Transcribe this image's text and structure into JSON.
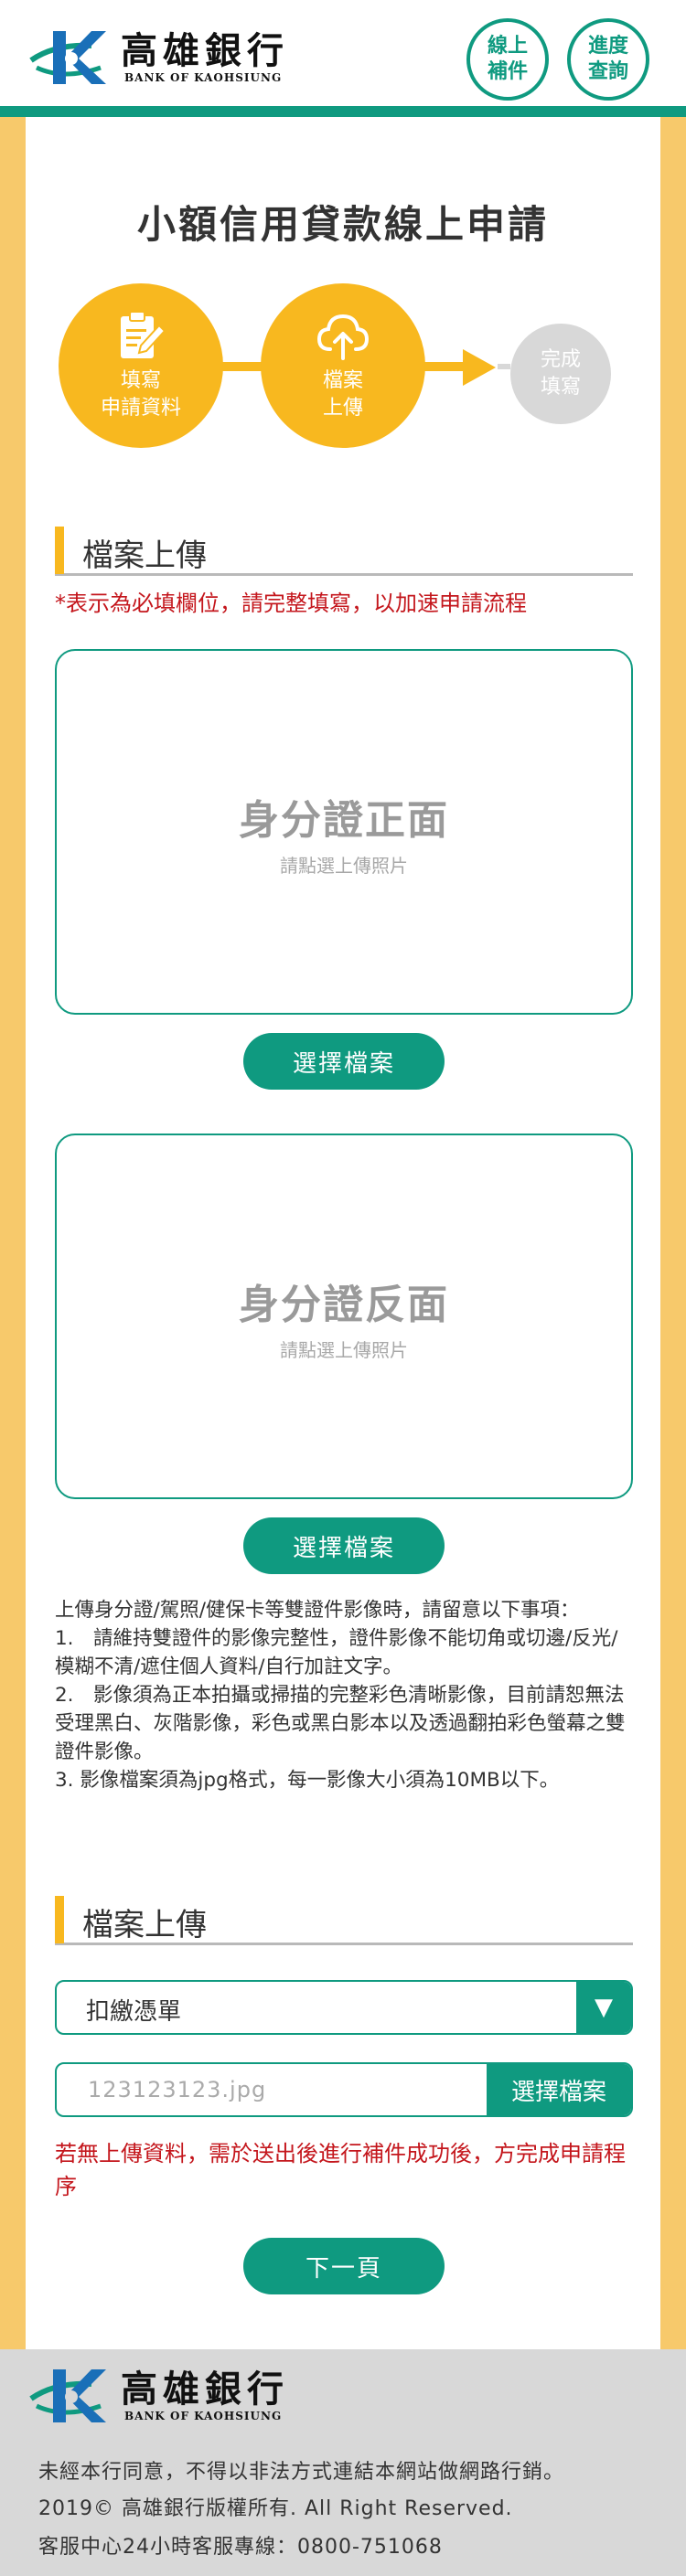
{
  "header": {
    "logo_cn": "高雄銀行",
    "logo_en": "BANK OF KAOHSIUNG",
    "btn_supplement": "線上\n補件",
    "btn_progress": "進度\n查詢"
  },
  "page": {
    "title": "小額信用貸款線上申請"
  },
  "steps": [
    {
      "label": "填寫\n申請資料",
      "icon": "form-edit-icon",
      "state": "done"
    },
    {
      "label": "檔案\n上傳",
      "icon": "cloud-upload-icon",
      "state": "current"
    },
    {
      "label": "完成\n填寫",
      "icon": "",
      "state": "pending"
    }
  ],
  "section1": {
    "title": "檔案上傳",
    "required_note": "*表示為必填欄位，請完整填寫，以加速申請流程"
  },
  "upload_front": {
    "title": "身分證正面",
    "hint": "請點選上傳照片",
    "button": "選擇檔案"
  },
  "upload_back": {
    "title": "身分證反面",
    "hint": "請點選上傳照片",
    "button": "選擇檔案"
  },
  "notice": {
    "intro": "上傳身分證/駕照/健保卡等雙證件影像時，請留意以下事項：",
    "item1": "1.　請維持雙證件的影像完整性，證件影像不能切角或切邊/反光/模糊不清/遮住個人資料/自行加註文字。",
    "item2": "2.　影像須為正本拍攝或掃描的完整彩色清晰影像，目前請恕無法受理黑白、灰階影像，彩色或黑白影本以及透過翻拍彩色螢幕之雙證件影像。",
    "item3": "3. 影像檔案須為jpg格式，每一影像大小須為10MB以下。"
  },
  "section2": {
    "title": "檔案上傳",
    "select_value": "扣繳憑單",
    "file_name": "123123123.jpg",
    "file_button": "選擇檔案",
    "warning": "若無上傳資料，需於送出後進行補件成功後，方完成申請程序",
    "next_button": "下一頁"
  },
  "footer": {
    "logo_cn": "高雄銀行",
    "logo_en": "BANK OF KAOHSIUNG",
    "line1": "未經本行同意，不得以非法方式連結本網站做網路行銷。",
    "line2": "2019© 高雄銀行版權所有. All Right Reserved.",
    "line3": "客服中心24小時客服專線：0800-751068"
  },
  "colors": {
    "brand_green": "#0f9a80",
    "accent_yellow": "#f8b81f",
    "warning_red": "#c4161c",
    "pending_gray": "#d8d8d8"
  }
}
